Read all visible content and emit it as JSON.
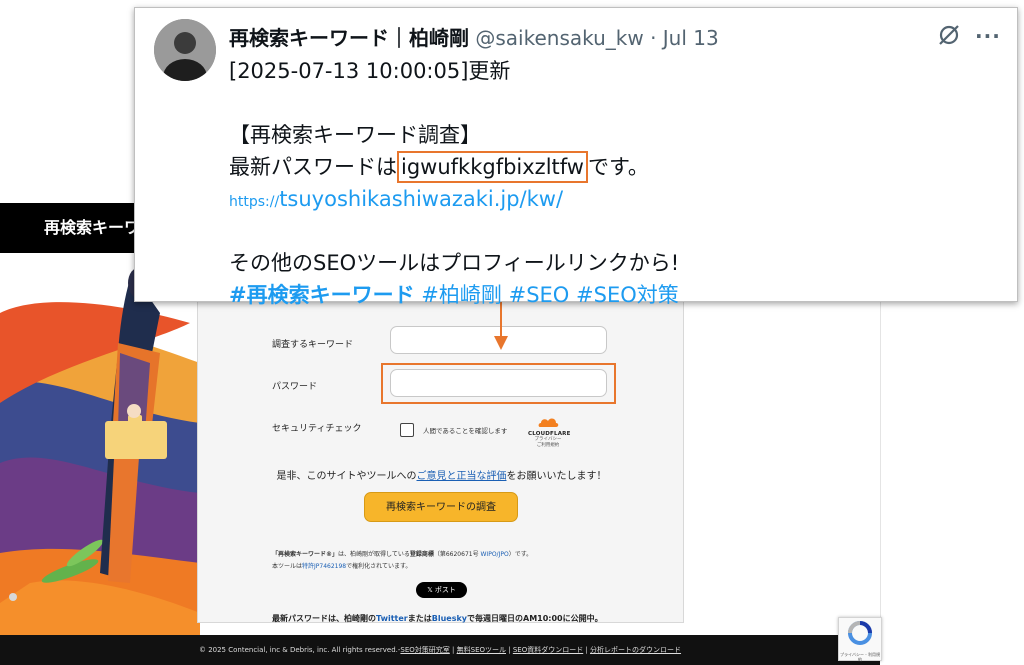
{
  "tweet": {
    "author_name": "再検索キーワード｜柏崎剛",
    "handle": "@saikensaku_kw",
    "date": "· Jul 13",
    "timestamp_line": "[2025-07-13 10:00:05]更新",
    "title_line": "【再検索キーワード調査】",
    "password_prefix": "最新パスワードは",
    "password": "igwufkkgfbixzltfw",
    "password_suffix": "です。",
    "link_protocol": "https://",
    "link_rest": "tsuyoshikashiwazaki.jp/kw/",
    "other_tools_line": "その他のSEOツールはプロフィールリンクから!",
    "hashtags": [
      "#再検索キーワード",
      "#柏崎剛",
      "#SEO",
      "#SEO対策"
    ]
  },
  "site": {
    "banner_title": "再検索キーワード",
    "form": {
      "keyword_label": "調査するキーワード",
      "keyword_value": "",
      "password_label": "パスワード",
      "password_value": "",
      "security_label": "セキュリティチェック",
      "captcha_text": "人間であることを確認します",
      "cloudflare_brand": "CLOUDFLARE",
      "cloudflare_privacy": "プライバシー",
      "cloudflare_terms": "ご利用規約",
      "request_prefix": "是非、このサイトやツールへの",
      "request_link": "ご意見と正当な評価",
      "request_suffix": "をお願いいたします！",
      "submit_label": "再検索キーワードの調査",
      "trademark_line1_bold": "「再検索キーワード®」",
      "trademark_line1_mid": "は、柏崎剛が取得している",
      "trademark_line1_reg": "登録商標",
      "trademark_line1_num": "（第6620671号 ",
      "trademark_line1_wipo": "WIPO/JPO",
      "trademark_line1_end": "）です。",
      "trademark_line2_pre": "本ツールは",
      "trademark_line2_link": "特許JP7462198",
      "trademark_line2_end": "で権利化されています。",
      "post_label": "𝕏 ポスト",
      "notice_prefix": "最新パスワードは、柏崎剛の",
      "notice_twitter": "Twitter",
      "notice_or": "または",
      "notice_bluesky": "Bluesky",
      "notice_suffix": "で毎週日曜日のAM10:00に公開中。"
    },
    "footer": {
      "copyright": "© 2025 Contencial, inc & Debris, inc. All rights reserved.-",
      "links": [
        "SEO対策研究室",
        "無料SEOツール",
        "SEO資料ダウンロード",
        "分析レポートのダウンロード"
      ]
    },
    "recaptcha_text": "プライバシー - 利用規約"
  },
  "colors": {
    "highlight": "#e8762d",
    "link_blue": "#1d9bf0",
    "button_yellow": "#f7b52a"
  },
  "icons": [
    "grok-icon",
    "more-icon",
    "checkbox-icon",
    "cloudflare-icon",
    "recaptcha-icon"
  ]
}
